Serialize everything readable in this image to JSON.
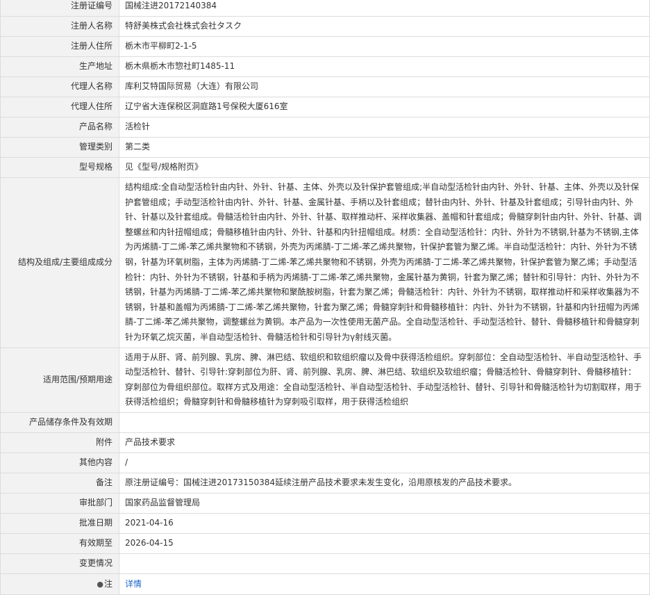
{
  "rows": [
    {
      "label": "注册证编号",
      "value": "国械注进20172140384"
    },
    {
      "label": "注册人名称",
      "value": "特舒美株式会社株式会社タスク"
    },
    {
      "label": "注册人住所",
      "value": "栃木市平柳町2-1-5"
    },
    {
      "label": "生产地址",
      "value": "栃木県栃木市惣社町1485-11"
    },
    {
      "label": "代理人名称",
      "value": "库利艾特国际贸易（大连）有限公司"
    },
    {
      "label": "代理人住所",
      "value": "辽宁省大连保税区洞庭路1号保税大厦616室"
    },
    {
      "label": "产品名称",
      "value": "活检针"
    },
    {
      "label": "管理类别",
      "value": "第二类"
    },
    {
      "label": "型号规格",
      "value": "见《型号/规格附页》"
    },
    {
      "label": "结构及组成/主要组成成分",
      "value": "结构组成:全自动型活检针由内针、外针、针基、主体、外壳以及针保护套管组成;半自动型活检针由内针、外针、针基、主体、外壳以及针保护套管组成；手动型活检针由内针、外针、针基、金属针基、手柄以及针套组成；替针由内针、外针、针基及针套组成；引导针由内针、外针、针基以及针套组成。骨髓活检针由内针、外针、针基、取样推动杆、采样收集器、盖帽和针套组成；骨髓穿刺针由内针、外针、针基、调整螺丝和内针扭帽组成；骨髓移植针由内针、外针、针基和内针扭帽组成。材质：全自动型活检针：内针、外针为不锈钢,针基为不锈钢,主体为丙烯腈-丁二烯-苯乙烯共聚物和不锈钢，外壳为丙烯腈-丁二烯-苯乙烯共聚物，针保护套管为聚乙烯。半自动型活检针：内针、外针为不锈钢，针基为环氧树脂，主体为丙烯腈-丁二烯-苯乙烯共聚物和不锈钢，外壳为丙烯腈-丁二烯-苯乙烯共聚物，针保护套管为聚乙烯；手动型活检针：内针、外针为不锈钢，针基和手柄为丙烯腈-丁二烯-苯乙烯共聚物，金属针基为黄铜，针套为聚乙烯；替针和引导针：内针、外针为不锈钢，针基为丙烯腈-丁二烯-苯乙烯共聚物和聚酰胺树脂，针套为聚乙烯；骨髓活检针：内针、外针为不锈钢，取样推动杆和采样收集器为不锈钢，针基和盖帽为丙烯腈-丁二烯-苯乙烯共聚物，针套为聚乙烯；骨髓穿刺针和骨髓移植针：内针、外针为不锈钢，针基和内针扭帽为丙烯腈-丁二烯-苯乙烯共聚物，调整螺丝为黄铜。本产品为一次性使用无菌产品。全自动型活检针、手动型活检针、替针、骨髓移植针和骨髓穿刺针为环氧乙烷灭菌，半自动型活检针、骨髓活检针和引导针为γ射线灭菌。"
    },
    {
      "label": "适用范围/预期用途",
      "value": "适用于从肝、肾、前列腺、乳房、脾、淋巴结、软组织和软组织瘤以及骨中获得活检组织。穿刺部位：全自动型活检针、半自动型活检针、手动型活检针、替针、引导针:穿刺部位为肝、肾、前列腺、乳房、脾、淋巴结、软组织及软组织瘤；骨髓活检针、骨髓穿刺针、骨髓移植针：穿刺部位为骨组织部位。取样方式及用途：全自动型活检针、半自动型活检针、手动型活检针、替针、引导针和骨髓活检针为切割取样，用于获得活检组织；骨髓穿刺针和骨髓移植针为穿刺吸引取样，用于获得活检组织"
    },
    {
      "label": "产品储存条件及有效期",
      "value": ""
    },
    {
      "label": "附件",
      "value": "产品技术要求"
    },
    {
      "label": "其他内容",
      "value": "/"
    },
    {
      "label": "备注",
      "value": "原注册证编号：国械注进20173150384延续注册产品技术要求未发生变化，沿用原核发的产品技术要求。"
    },
    {
      "label": "审批部门",
      "value": "国家药品监督管理局"
    },
    {
      "label": "批准日期",
      "value": "2021-04-16"
    },
    {
      "label": "有效期至",
      "value": "2026-04-15"
    },
    {
      "label": "变更情况",
      "value": ""
    }
  ],
  "note": {
    "label": "注",
    "icon": "pin-icon",
    "link_text": "详情"
  }
}
